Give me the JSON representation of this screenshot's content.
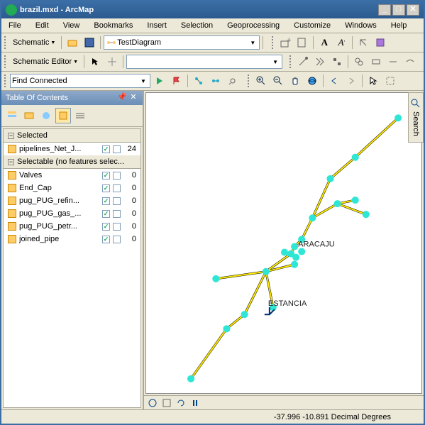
{
  "window": {
    "title": "brazil.mxd - ArcMap"
  },
  "menu": {
    "items": [
      "File",
      "Edit",
      "View",
      "Bookmarks",
      "Insert",
      "Selection",
      "Geoprocessing",
      "Customize",
      "Windows",
      "Help"
    ]
  },
  "toolbar1": {
    "schematic": "Schematic",
    "diagram": "TestDiagram",
    "bold": "A",
    "italic": "A"
  },
  "toolbar2": {
    "editor": "Schematic Editor"
  },
  "toolbar3": {
    "find": "Find Connected"
  },
  "toc": {
    "title": "Table Of Contents",
    "sections": {
      "selected": "Selected",
      "selectable": "Selectable (no features selec..."
    },
    "selectedItems": [
      {
        "label": "pipelines_Net_J...",
        "count": "24"
      }
    ],
    "selectableItems": [
      {
        "label": "Valves",
        "count": "0"
      },
      {
        "label": "End_Cap",
        "count": "0"
      },
      {
        "label": "pug_PUG_refin...",
        "count": "0"
      },
      {
        "label": "pug_PUG_gas_...",
        "count": "0"
      },
      {
        "label": "pug_PUG_petr...",
        "count": "0"
      },
      {
        "label": "joined_pipe",
        "count": "0"
      }
    ]
  },
  "map": {
    "labels": {
      "aracaju": "ARACAJU",
      "estancia": "ESTANCIA"
    }
  },
  "status": {
    "coords": "-37.996  -10.891 Decimal Degrees"
  },
  "sidetab": {
    "label": "Search"
  }
}
